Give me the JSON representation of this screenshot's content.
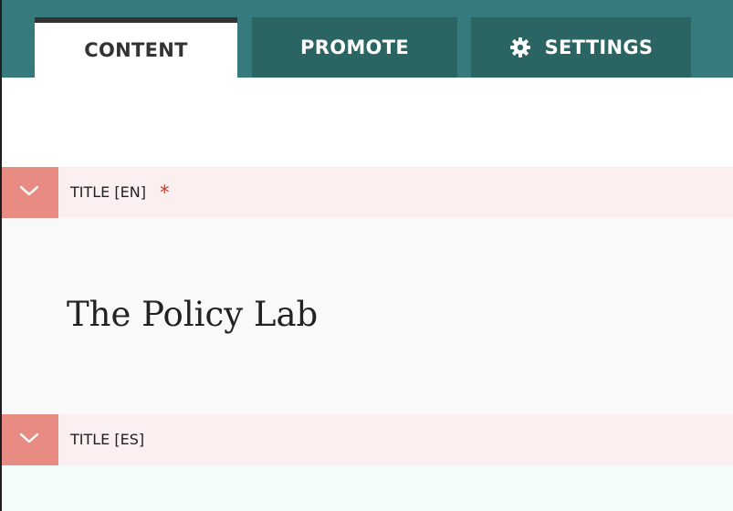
{
  "tabs": {
    "content_label": "CONTENT",
    "promote_label": "PROMOTE",
    "settings_label": "SETTINGS"
  },
  "fields": {
    "title_en": {
      "label": "TITLE [EN]",
      "required_marker": "*",
      "value": "The Policy Lab"
    },
    "title_es": {
      "label": "TITLE [ES]"
    }
  },
  "icons": {
    "settings": "gear-icon",
    "toggle": "chevron-down-icon"
  },
  "colors": {
    "tab_bar": "#367a7e",
    "tab_inactive": "#2a6563",
    "toggle_accent": "#e88b82",
    "field_header_bg": "#fbefef",
    "required": "#c0392b"
  }
}
